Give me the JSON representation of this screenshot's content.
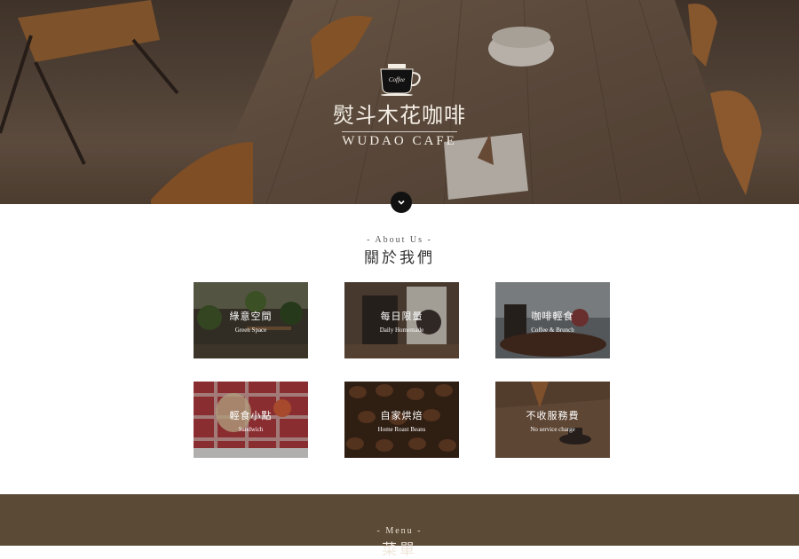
{
  "hero": {
    "logo_text": "Coffee",
    "brand_zh": "熨斗木花咖啡",
    "brand_en": "WUDAO CAFE"
  },
  "about": {
    "eyebrow": "- About Us -",
    "title": "關於我們",
    "cards": [
      {
        "zh": "綠意空間",
        "en": "Green Space"
      },
      {
        "zh": "每日限量",
        "en": "Daily Homemade"
      },
      {
        "zh": "咖啡輕食",
        "en": "Coffee & Brunch"
      },
      {
        "zh": "輕食小點",
        "en": "Sandwich"
      },
      {
        "zh": "自家烘焙",
        "en": "Home Roast Beans"
      },
      {
        "zh": "不收服務費",
        "en": "No service charge"
      }
    ]
  },
  "menu": {
    "eyebrow": "- Menu -",
    "title": "菜單"
  },
  "colors": {
    "menu_bg": "#5b4a36",
    "scroll_button": "#111111"
  }
}
